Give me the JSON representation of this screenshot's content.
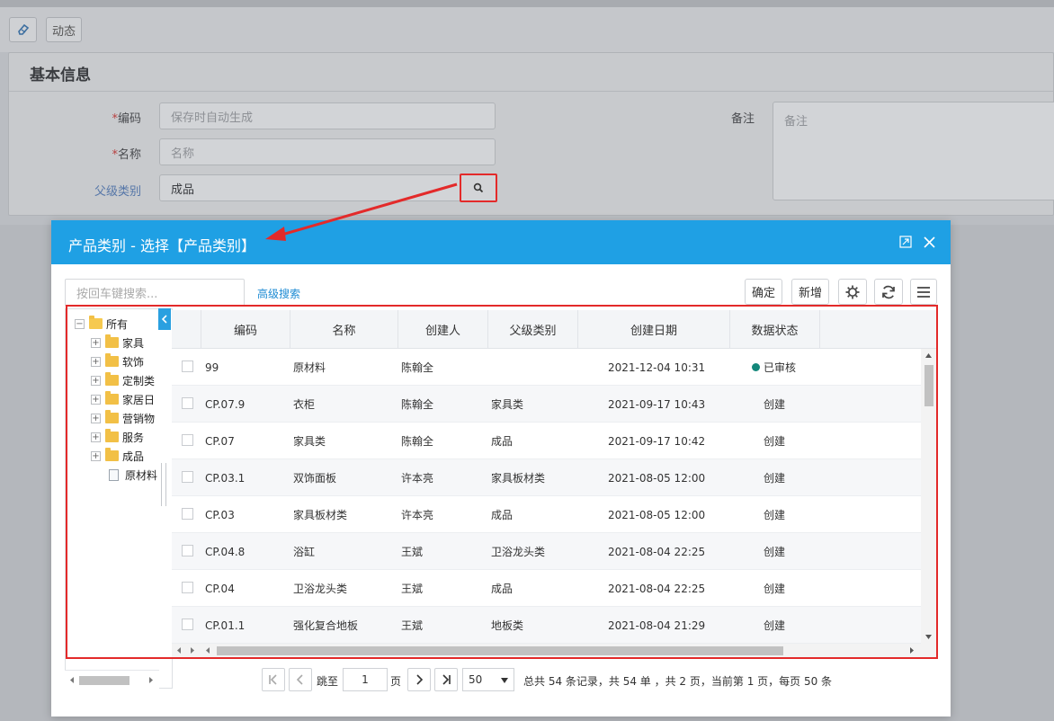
{
  "toolbar": {
    "dynamics_label": "动态"
  },
  "form": {
    "section_title": "基本信息",
    "code": {
      "label": "编码",
      "placeholder": "保存时自动生成"
    },
    "name": {
      "label": "名称",
      "placeholder": "名称"
    },
    "parent": {
      "label": "父级类别",
      "value": "成品"
    },
    "remark": {
      "label": "备注",
      "placeholder": "备注"
    },
    "required_mark": "*"
  },
  "dialog": {
    "title": "产品类别 - 选择【产品类别】",
    "search_placeholder": "按回车键搜索...",
    "advanced_search": "高级搜索",
    "confirm_label": "确定",
    "add_label": "新增"
  },
  "tree": {
    "root": "所有",
    "children": [
      "家具",
      "软饰",
      "定制类",
      "家居日",
      "营销物",
      "服务",
      "成品"
    ],
    "leaf": "原材料"
  },
  "grid": {
    "columns": [
      "编码",
      "名称",
      "创建人",
      "父级类别",
      "创建日期",
      "数据状态"
    ],
    "rows": [
      [
        "99",
        "原材料",
        "陈翰全",
        "",
        "2021-12-04 10:31",
        "已审核"
      ],
      [
        "CP.07.9",
        "衣柜",
        "陈翰全",
        "家具类",
        "2021-09-17 10:43",
        "创建"
      ],
      [
        "CP.07",
        "家具类",
        "陈翰全",
        "成品",
        "2021-09-17 10:42",
        "创建"
      ],
      [
        "CP.03.1",
        "双饰面板",
        "许本亮",
        "家具板材类",
        "2021-08-05 12:00",
        "创建"
      ],
      [
        "CP.03",
        "家具板材类",
        "许本亮",
        "成品",
        "2021-08-05 12:00",
        "创建"
      ],
      [
        "CP.04.8",
        "浴缸",
        "王斌",
        "卫浴龙头类",
        "2021-08-04 22:25",
        "创建"
      ],
      [
        "CP.04",
        "卫浴龙头类",
        "王斌",
        "成品",
        "2021-08-04 22:25",
        "创建"
      ],
      [
        "CP.01.1",
        "强化复合地板",
        "王斌",
        "地板类",
        "2021-08-04 21:29",
        "创建"
      ]
    ]
  },
  "pager": {
    "goto_label": "跳至",
    "page_value": "1",
    "page_unit": "页",
    "page_size": "50",
    "summary": "总共 54 条记录，共 54 单 ，共 2 页，当前第 1 页，每页 50 条"
  },
  "colors": {
    "accent": "#1fa0e4",
    "highlight": "#e32a2a",
    "approved": "#13877a"
  }
}
